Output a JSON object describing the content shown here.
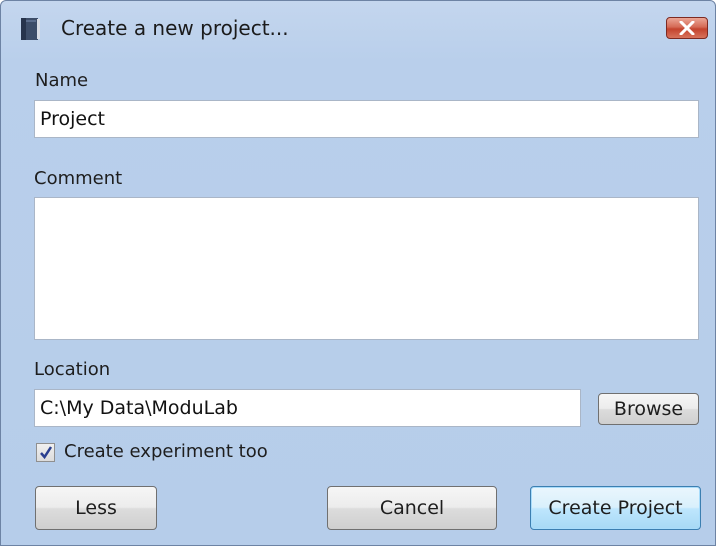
{
  "window": {
    "title": "Create a new project..."
  },
  "icons": {
    "app": "book-icon",
    "close": "close-icon",
    "check": "checkmark-icon"
  },
  "colors": {
    "window_background": "#b9cfeb",
    "close_button": "#c4432d",
    "default_button_border": "#3c7fb1"
  },
  "form": {
    "name_label": "Name",
    "name_value": "Project",
    "comment_label": "Comment",
    "comment_value": "",
    "location_label": "Location",
    "location_value": "C:\\My Data\\ModuLab",
    "browse_label": "Browse",
    "create_experiment_label": "Create experiment too",
    "create_experiment_checked": true
  },
  "buttons": {
    "less": "Less",
    "cancel": "Cancel",
    "create_project": "Create Project"
  }
}
